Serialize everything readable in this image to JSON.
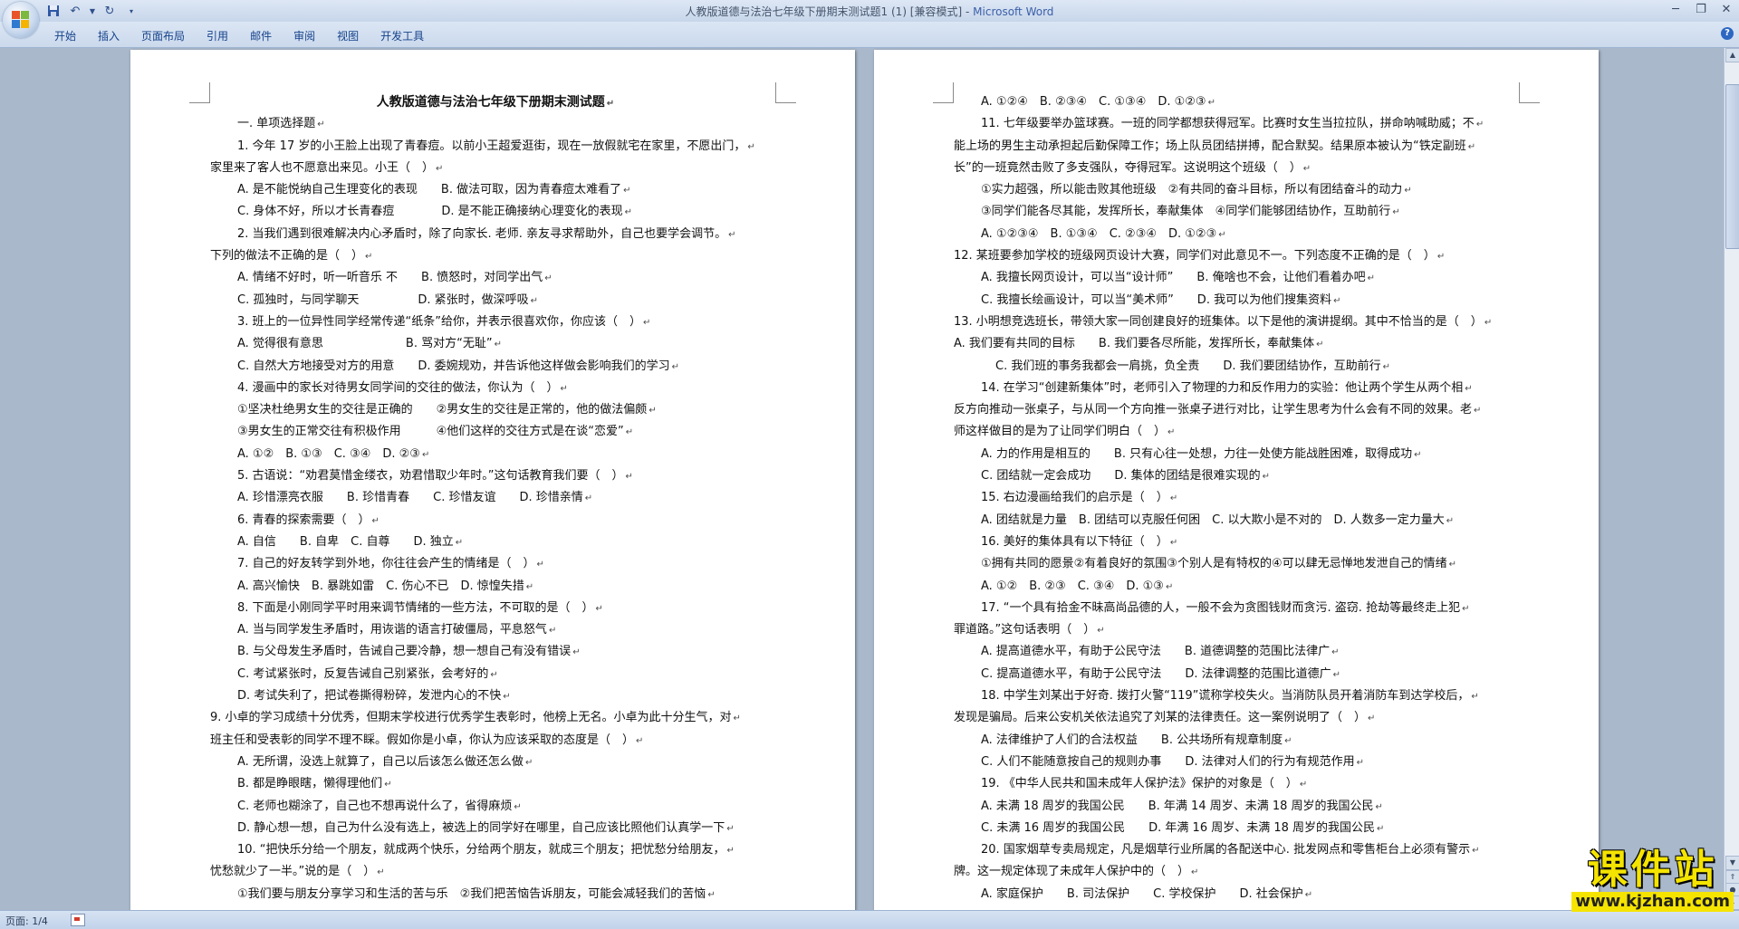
{
  "window": {
    "document_name": "人教版道德与法治七年级下册期末测试题1 (1) [兼容模式]",
    "separator": " - ",
    "app_name": "Microsoft Word"
  },
  "ribbon": {
    "tabs": [
      "开始",
      "插入",
      "页面布局",
      "引用",
      "邮件",
      "审阅",
      "视图",
      "开发工具"
    ]
  },
  "status_bar": {
    "page_count": "页面: 1/4"
  },
  "watermark": {
    "big": "课件站",
    "url": "www.kjzhan.com"
  },
  "left_page": {
    "lines": [
      "人教版道德与法治七年级下册期末测试题",
      "一. 单项选择题",
      "1. 今年 17 岁的小王脸上出现了青春痘。以前小王超爱逛街，现在一放假就宅在家里，不愿出门，",
      "家里来了客人也不愿意出来见。小王（　）",
      "A. 是不能悦纳自己生理变化的表现　　B. 做法可取，因为青春痘太难看了",
      "C. 身体不好，所以才长青春痘　　　　D. 是不能正确接纳心理变化的表现",
      "2. 当我们遇到很难解决内心矛盾时，除了向家长. 老师. 亲友寻求帮助外，自己也要学会调节。",
      "下列的做法不正确的是（　）",
      "A. 情绪不好时，听一听音乐 不　　B. 愤怒时，对同学出气",
      "C. 孤独时，与同学聊天　　　　　D. 紧张时，做深呼吸",
      "3. 班上的一位异性同学经常传递“纸条”给你，并表示很喜欢你，你应该（　）",
      "A. 觉得很有意思　　　　　　　B. 骂对方“无耻”",
      "C. 自然大方地接受对方的用意　　D. 委婉规劝，并告诉他这样做会影响我们的学习",
      "4. 漫画中的家长对待男女同学间的交往的做法，你认为（　）",
      "①坚决杜绝男女生的交往是正确的　　②男女生的交往是正常的，他的做法偏颇",
      "③男女生的正常交往有积极作用　　　④他们这样的交往方式是在谈“恋爱”",
      "A. ①②　B. ①③　C. ③④　D. ②③",
      "5. 古语说：“劝君莫惜金缕衣，劝君惜取少年时。”这句话教育我们要（　）",
      "A. 珍惜漂亮衣服　　B. 珍惜青春　　C. 珍惜友谊　　D. 珍惜亲情",
      "6. 青春的探索需要（　）",
      "A. 自信　　B. 自卑　C. 自尊　　D. 独立",
      "7. 自己的好友转学到外地，你往往会产生的情绪是（　）",
      "A. 高兴愉快　B. 暴跳如雷　C. 伤心不已　D. 惊惶失措",
      "8. 下面是小刚同学平时用来调节情绪的一些方法，不可取的是（　）",
      "A. 当与同学发生矛盾时，用诙谐的语言打破僵局，平息怒气",
      "B. 与父母发生矛盾时，告诫自己要冷静，想一想自己有没有错误",
      "C. 考试紧张时，反复告诫自己别紧张，会考好的",
      "D. 考试失利了，把试卷撕得粉碎，发泄内心的不快",
      "9. 小卓的学习成绩十分优秀，但期末学校进行优秀学生表彰时，他榜上无名。小卓为此十分生气，对",
      "班主任和受表彰的同学不理不睬。假如你是小卓，你认为应该采取的态度是（　）",
      "A. 无所谓，没选上就算了，自己以后该怎么做还怎么做",
      "B. 都是睁眼瞎，懒得理他们",
      "C. 老师也糊涂了，自己也不想再说什么了，省得麻烦",
      "D. 静心想一想，自己为什么没有选上，被选上的同学好在哪里，自己应该比照他们认真学一下",
      "10. “把快乐分给一个朋友，就成两个快乐，分给两个朋友，就成三个朋友；把忧愁分给朋友，",
      "忧愁就少了一半。”说的是（　）",
      "①我们要与朋友分享学习和生活的苦与乐　②我们把苦恼告诉朋友，可能会减轻我们的苦恼"
    ]
  },
  "right_page": {
    "lines": [
      "A. ①②④　B. ②③④　C. ①③④　D. ①②③",
      "11. 七年级要举办篮球赛。一班的同学都想获得冠军。比赛时女生当拉拉队，拼命呐喊助威；不",
      "能上场的男生主动承担起后勤保障工作；场上队员团结拼搏，配合默契。结果原本被认为“铁定副班",
      "长”的一班竟然击败了多支强队，夺得冠军。这说明这个班级（　）",
      "①实力超强，所以能击败其他班级　②有共同的奋斗目标，所以有团结奋斗的动力",
      "③同学们能各尽其能，发挥所长，奉献集体　④同学们能够团结协作，互助前行",
      "A. ①②③④　B. ①③④　C. ②③④　D. ①②③",
      "12. 某班要参加学校的班级网页设计大赛，同学们对此意见不一。下列态度不正确的是（　）",
      "A. 我擅长网页设计，可以当“设计师”　　B. 俺啥也不会，让他们看着办吧",
      "C. 我擅长绘画设计，可以当“美术师”　　D. 我可以为他们搜集资料",
      "13. 小明想竞选班长，带领大家一同创建良好的班集体。以下是他的演讲提纲。其中不恰当的是（　）",
      "A. 我们要有共同的目标　　B. 我们要各尽所能，发挥所长，奉献集体",
      "C. 我们班的事务我都会一肩挑，负全责　　D. 我们要团结协作，互助前行",
      "14. 在学习“创建新集体”时，老师引入了物理的力和反作用力的实验：他让两个学生从两个相",
      "反方向推动一张桌子，与从同一个方向推一张桌子进行对比，让学生思考为什么会有不同的效果。老",
      "师这样做目的是为了让同学们明白（　）",
      "A. 力的作用是相互的　　B. 只有心往一处想，力往一处使方能战胜困难，取得成功",
      "C. 团结就一定会成功　　D. 集体的团结是很难实现的",
      "15. 右边漫画给我们的启示是（　）",
      "A. 团结就是力量　B. 团结可以克服任何困　C. 以大欺小是不对的　D. 人数多一定力量大",
      "16. 美好的集体具有以下特征（　）",
      "①拥有共同的愿景②有着良好的氛围③个别人是有特权的④可以肆无忌惮地发泄自己的情绪",
      "A. ①②　B. ②③　C. ③④　D. ①③",
      "17. “一个具有拾金不昧高尚品德的人，一般不会为贪图钱财而贪污. 盗窃. 抢劫等最终走上犯",
      "罪道路。”这句话表明（　）",
      "A. 提高道德水平，有助于公民守法　　B. 道德调整的范围比法律广",
      "C. 提高道德水平，有助于公民守法　　D. 法律调整的范围比道德广",
      "18. 中学生刘某出于好奇. 拨打火警“119”谎称学校失火。当消防队员开着消防车到达学校后，",
      "发现是骗局。后来公安机关依法追究了刘某的法律责任。这一案例说明了（　）",
      "A. 法律维护了人们的合法权益　　B. 公共场所有规章制度",
      "C. 人们不能随意按自己的规则办事　　D. 法律对人们的行为有规范作用",
      "19. 《中华人民共和国未成年人保护法》保护的对象是（　）",
      "A. 未满 18 周岁的我国公民　　B. 年满 14 周岁、未满 18 周岁的我国公民",
      "C. 未满 16 周岁的我国公民　　D. 年满 16 周岁、未满 18 周岁的我国公民",
      "20. 国家烟草专卖局规定，凡是烟草行业所属的各配送中心. 批发网点和零售柜台上必须有警示",
      "牌。这一规定体现了未成年人保护中的（　）",
      "A. 家庭保护　　B. 司法保护　　C. 学校保护　　D. 社会保护"
    ]
  }
}
